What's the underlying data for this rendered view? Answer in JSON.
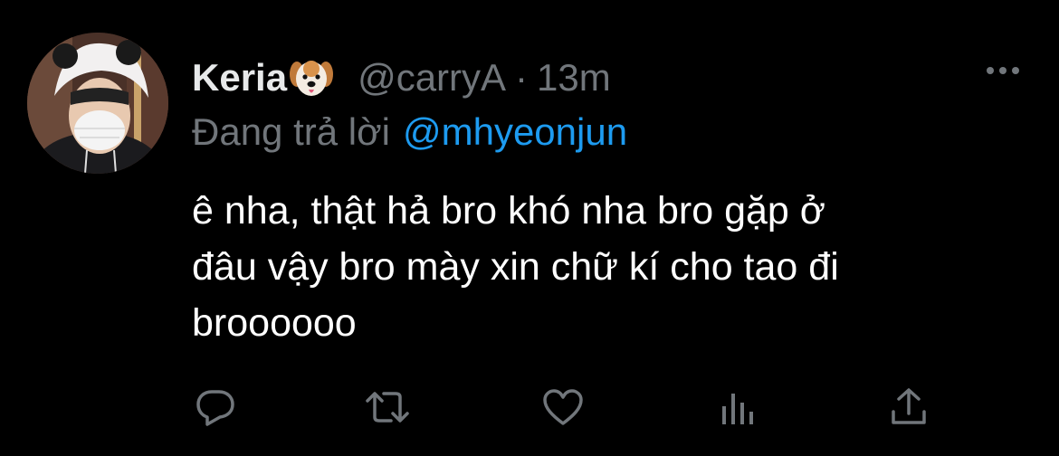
{
  "tweet": {
    "display_name": "Keria",
    "badge_emoji_icon": "dog-face-icon",
    "handle": "@carryA",
    "separator": "·",
    "time": "13m",
    "reply_label": "Đang trả lời",
    "reply_mention": "@mhyeonjun",
    "text_lines": [
      "ê nha, thật hả bro khó nha bro gặp ở",
      "đâu vậy bro mày xin chữ kí cho tao đi",
      "broooooo"
    ]
  },
  "actions": [
    {
      "icon": "reply-icon"
    },
    {
      "icon": "retweet-icon"
    },
    {
      "icon": "like-icon"
    },
    {
      "icon": "analytics-icon"
    },
    {
      "icon": "share-icon"
    }
  ],
  "colors": {
    "background": "#000000",
    "name": "#e7e9ea",
    "secondary": "#71767b",
    "mention": "#1d9bf0",
    "body": "#ffffff"
  }
}
